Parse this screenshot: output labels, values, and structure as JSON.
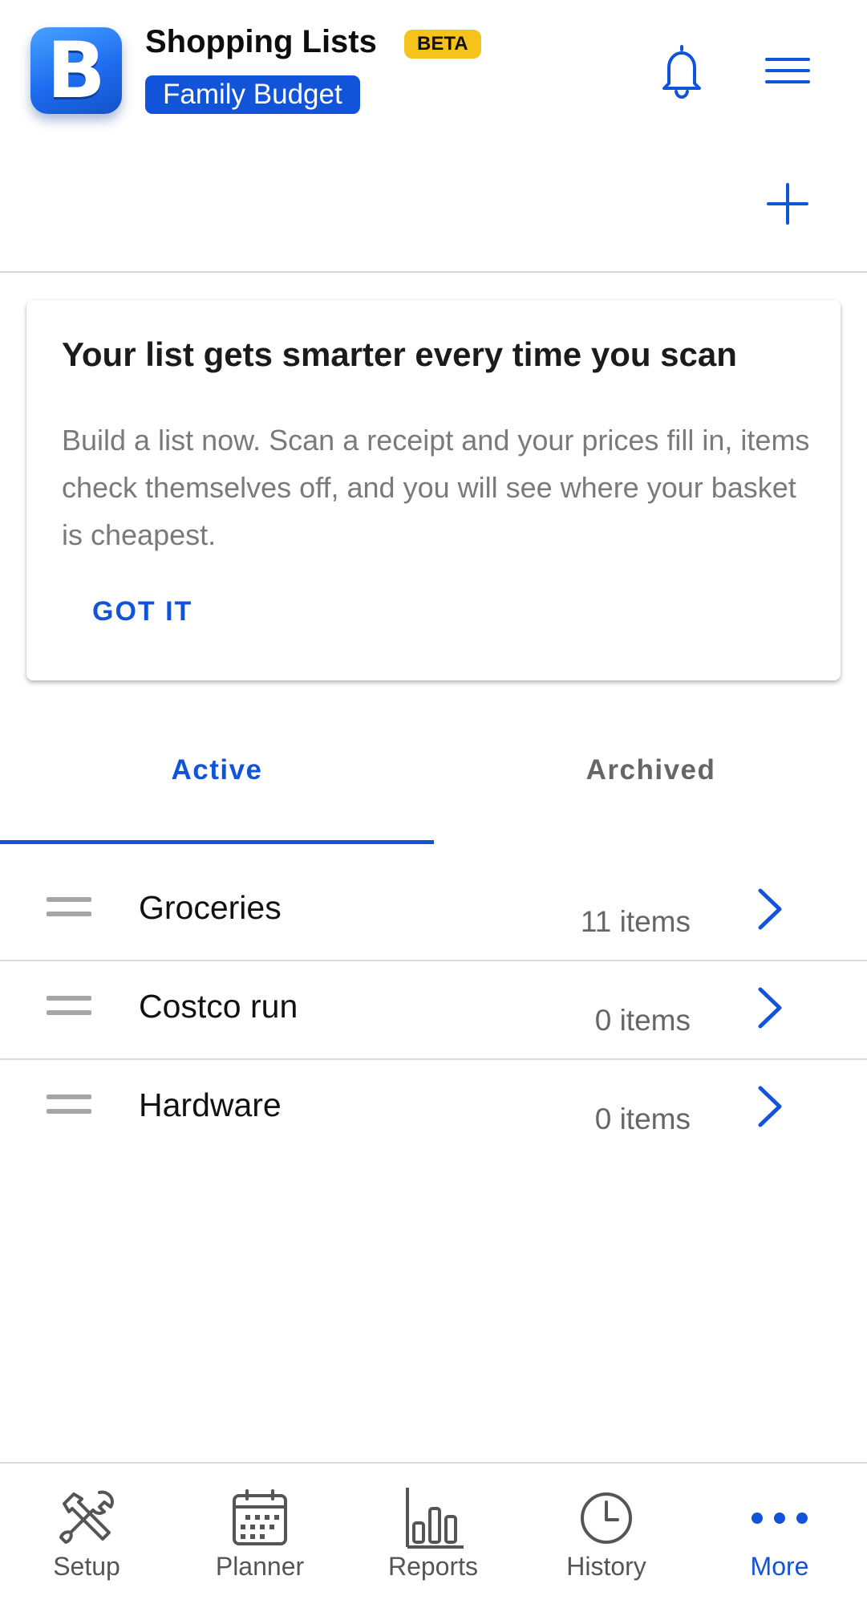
{
  "header": {
    "logo_letter": "B",
    "title": "Shopping Lists",
    "beta_badge": "BETA",
    "budget_name": "Family Budget"
  },
  "tip_card": {
    "title": "Your list gets smarter every time you scan",
    "body": "Build a list now. Scan a receipt and your prices fill in, items check themselves off, and you will see where your basket is cheapest.",
    "dismiss_label": "GOT IT"
  },
  "tabs": [
    {
      "label": "Active",
      "selected": true
    },
    {
      "label": "Archived",
      "selected": false
    }
  ],
  "lists": [
    {
      "name": "Groceries",
      "count": "11 items"
    },
    {
      "name": "Costco run",
      "count": "0 items"
    },
    {
      "name": "Hardware",
      "count": "0 items"
    }
  ],
  "bottom_nav": [
    {
      "label": "Setup",
      "icon": "tools-icon",
      "active": false
    },
    {
      "label": "Planner",
      "icon": "calendar-icon",
      "active": false
    },
    {
      "label": "Reports",
      "icon": "bar-chart-icon",
      "active": false
    },
    {
      "label": "History",
      "icon": "clock-icon",
      "active": false
    },
    {
      "label": "More",
      "icon": "more-dots-icon",
      "active": true
    }
  ],
  "colors": {
    "accent": "#1254d9",
    "badge": "#f6c21c",
    "muted_text": "#7a7a7a",
    "divider": "#dadada"
  }
}
